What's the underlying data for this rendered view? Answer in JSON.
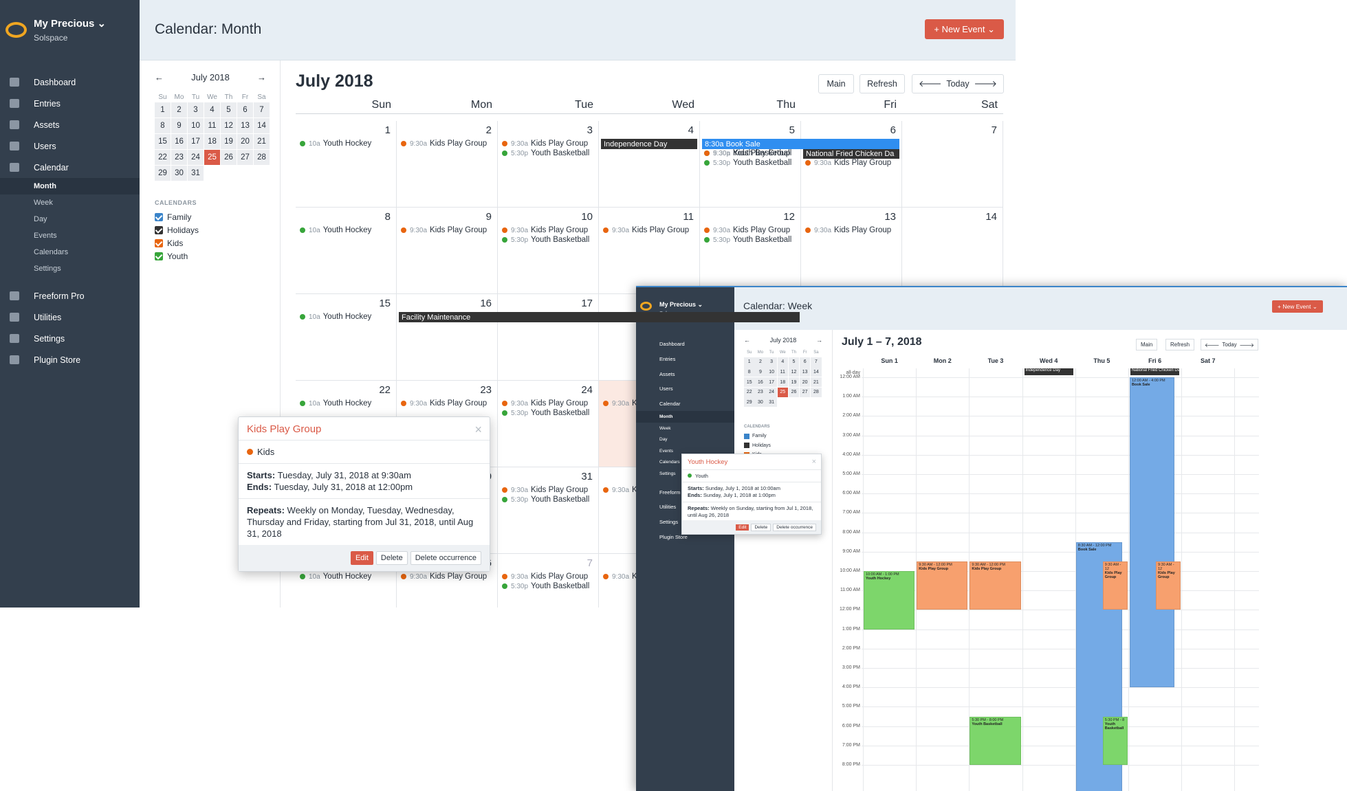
{
  "month": {
    "site": "My Precious ⌄",
    "subsite": "Solspace",
    "title": "Calendar: Month",
    "new_event": "+ New Event ⌄",
    "nav": [
      "Dashboard",
      "Entries",
      "Assets",
      "Users",
      "Calendar"
    ],
    "subnav": [
      "Month",
      "Week",
      "Day",
      "Events",
      "Calendars",
      "Settings"
    ],
    "nav2": [
      "Freeform Pro",
      "Utilities",
      "Settings",
      "Plugin Store"
    ],
    "mini": {
      "month": "July 2018",
      "prev": "←",
      "next": "→",
      "heads": [
        "Su",
        "Mo",
        "Tu",
        "We",
        "Th",
        "Fr",
        "Sa"
      ],
      "days": [
        "1",
        "2",
        "3",
        "4",
        "5",
        "6",
        "7",
        "8",
        "9",
        "10",
        "11",
        "12",
        "13",
        "14",
        "15",
        "16",
        "17",
        "18",
        "19",
        "20",
        "21",
        "22",
        "23",
        "24",
        "25",
        "26",
        "27",
        "28",
        "29",
        "30",
        "31"
      ]
    },
    "calendars_label": "CALENDARS",
    "calendars": [
      {
        "name": "Family",
        "color": "#3a84c9"
      },
      {
        "name": "Holidays",
        "color": "#333"
      },
      {
        "name": "Kids",
        "color": "#e8650f"
      },
      {
        "name": "Youth",
        "color": "#37a53a"
      }
    ],
    "heading": "July 2018",
    "buttons": [
      "Main",
      "Refresh",
      "Today"
    ],
    "weekdays": [
      "Sun",
      "Mon",
      "Tue",
      "Wed",
      "Thu",
      "Fri",
      "Sat"
    ],
    "ev": {
      "hockey": "Youth Hockey",
      "kids": "Kids Play Group",
      "basket": "Youth Basketball",
      "t10": "10a",
      "t930": "9:30a",
      "t530": "5:30p",
      "indep": "Independence Day",
      "book": "8:30a Book Sale",
      "chicken": "National Fried Chicken Da",
      "facility": "Facility Maintenance",
      "kzero": "9:30a K"
    },
    "popup": {
      "title": "Kids Play Group",
      "cal": "Kids",
      "starts_l": "Starts:",
      "starts": " Tuesday, July 31, 2018 at 9:30am",
      "ends_l": "Ends:",
      "ends": " Tuesday, July 31, 2018 at 12:00pm",
      "rep_l": "Repeats:",
      "rep": " Weekly on Monday, Tuesday, Wednesday, Thursday and Friday, starting from Jul 31, 2018, until Aug 31, 2018",
      "edit": "Edit",
      "delete": "Delete",
      "delocc": "Delete occurrence"
    }
  },
  "week": {
    "title": "Calendar: Week",
    "heading": "July 1 – 7, 2018",
    "days": [
      "Sun  1",
      "Mon  2",
      "Tue  3",
      "Wed  4",
      "Thu  5",
      "Fri  6",
      "Sat  7"
    ],
    "allday": "all-day",
    "hours": [
      "12:00 AM",
      "1:00 AM",
      "2:00 AM",
      "3:00 AM",
      "4:00 AM",
      "5:00 AM",
      "6:00 AM",
      "7:00 AM",
      "8:00 AM",
      "9:00 AM",
      "10:00 AM",
      "11:00 AM",
      "12:00 PM",
      "1:00 PM",
      "2:00 PM",
      "3:00 PM",
      "4:00 PM",
      "5:00 PM",
      "6:00 PM",
      "7:00 PM",
      "8:00 PM"
    ],
    "booksale_t": "12:00 AM - 4:00 PM",
    "booksale": "Book Sale",
    "bs2_t": "8:30 AM - 12:00 PM",
    "hockey_t": "10:00 AM - 1:00 PM",
    "kids_t": "9:30 AM - 12:00 PM",
    "kids_t2": "9:30 AM - 12",
    "basket_t": "5:30 PM - 8:00 PM",
    "basket_t2": "5:30 PM - 8",
    "popup": {
      "title": "Youth Hockey",
      "cal": "Youth",
      "starts_l": "Starts:",
      "starts": " Sunday, July 1, 2018 at 10:00am",
      "ends_l": "Ends:",
      "ends": " Sunday, July 1, 2018 at 1:00pm",
      "rep_l": "Repeats:",
      "rep": " Weekly on Sunday, starting from Jul 1, 2018, until Aug 26, 2018"
    }
  },
  "colors": {
    "red": "#da5a47",
    "sidebar": "#333f4d",
    "kids": "#e8650f",
    "youth": "#37a53a",
    "family": "#3a84c9",
    "holiday": "#333"
  }
}
